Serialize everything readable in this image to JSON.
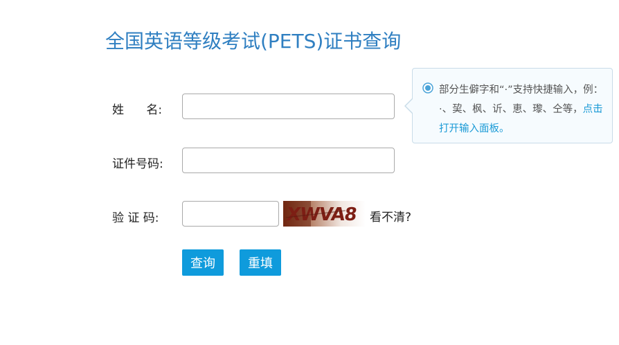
{
  "page": {
    "title": "全国英语等级考试(PETS)证书查询"
  },
  "form": {
    "name_label": "姓      名:",
    "name_value": "",
    "id_label": "证件号码:",
    "id_value": "",
    "captcha_label": "验 证 码:",
    "captcha_value": "",
    "captcha_image_text": "XWVA8",
    "refresh_link": "看不清?",
    "query_button": "查询",
    "reset_button": "重填"
  },
  "tooltip": {
    "icon": "info-radio-icon",
    "text": "部分生僻字和“·”支持快捷输入，例：·、巭、枫、䜣、恵、瓈、仝等，",
    "link": "点击打开输入面板。"
  },
  "colors": {
    "title": "#2f7fc1",
    "button": "#0f9bdc",
    "link": "#1a9ad6"
  }
}
